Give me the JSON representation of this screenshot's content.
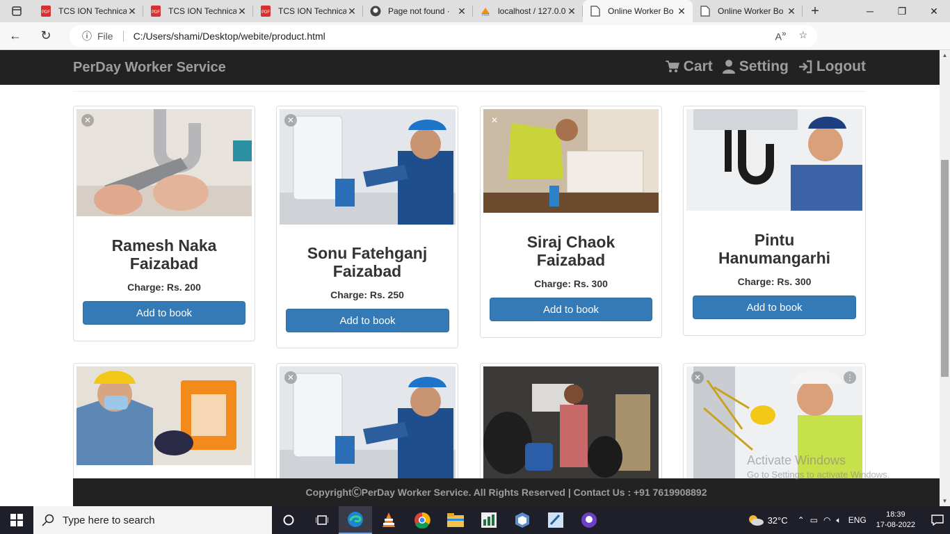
{
  "browser": {
    "tabs": [
      {
        "title": "TCS ION Technica",
        "icon": "pdf-icon",
        "active": false
      },
      {
        "title": "TCS ION Technica",
        "icon": "pdf-icon",
        "active": false
      },
      {
        "title": "TCS ION Technica",
        "icon": "pdf-icon",
        "active": false
      },
      {
        "title": "Page not found ·",
        "icon": "github-icon",
        "active": false
      },
      {
        "title": "localhost / 127.0.0",
        "icon": "phpmyadmin-icon",
        "active": false
      },
      {
        "title": "Online Worker Bo",
        "icon": "page-icon",
        "active": true
      },
      {
        "title": "Online Worker Bo",
        "icon": "page-icon",
        "active": false
      }
    ],
    "address": {
      "scheme_label": "File",
      "url": "C:/Users/shami/Desktop/webite/product.html"
    }
  },
  "site": {
    "brand": "PerDay Worker Service",
    "nav": {
      "cart": "Cart",
      "setting": "Setting",
      "logout": "Logout"
    },
    "book_button": "Add to book",
    "workers": [
      {
        "name": "Ramesh Naka Faizabad",
        "charge": "Charge: Rs. 200",
        "image": "plumber-pipe-wrench"
      },
      {
        "name": "Sonu Fatehganj Faizabad",
        "charge": "Charge: Rs. 250",
        "image": "plumber-blue-cap"
      },
      {
        "name": "Siraj Chaok Faizabad",
        "charge": "Charge: Rs. 300",
        "image": "worker-yellow-vest"
      },
      {
        "name": "Pintu Hanumangarhi",
        "charge": "Charge: Rs. 300",
        "image": "plumber-sink"
      },
      {
        "name": "",
        "charge": "",
        "image": "electrician-mask"
      },
      {
        "name": "",
        "charge": "",
        "image": "plumber-blue-cap"
      },
      {
        "name": "",
        "charge": "",
        "image": "tyre-shop-worker"
      },
      {
        "name": "",
        "charge": "",
        "image": "electrician-helmet"
      }
    ],
    "footer": "CopyrightⒸPerDay Worker Service. All Rights Reserved | Contact Us : +91 7619908892",
    "watermark": {
      "line1": "Activate Windows",
      "line2": "Go to Settings to activate Windows."
    }
  },
  "taskbar": {
    "search_placeholder": "Type here to search",
    "weather": "32°C",
    "language": "ENG",
    "time": "18:39",
    "date": "17-08-2022",
    "pinned": [
      "task-view-icon",
      "edge-icon",
      "vlc-icon",
      "chrome-icon",
      "file-explorer-icon",
      "spreadsheet-icon",
      "virtualbox-icon",
      "notepad-icon",
      "github-desktop-icon"
    ]
  },
  "colors": {
    "navbar_bg": "#222222",
    "navbar_text": "#9d9d9d",
    "button_primary": "#337ab7",
    "taskbar_bg": "#1f1f2a"
  }
}
